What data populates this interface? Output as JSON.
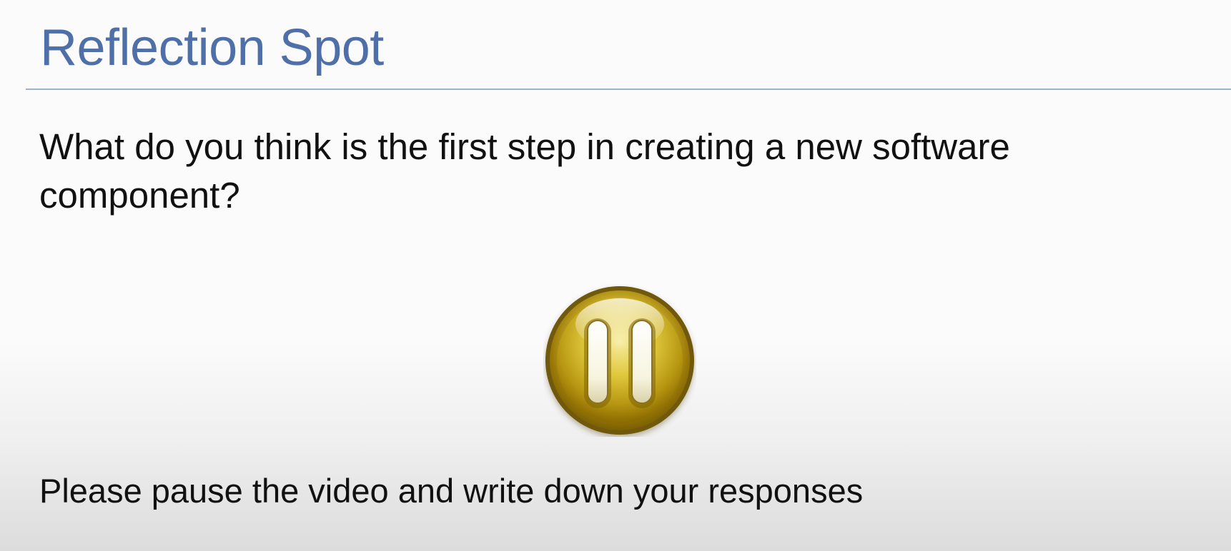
{
  "slide": {
    "title": "Reflection Spot",
    "question": "What do you think is the first step in creating a new software component?",
    "instruction": "Please pause the video and write down your responses",
    "pause_icon": "pause-icon"
  },
  "colors": {
    "title": "#4f6fa8",
    "rule": "#9cb1cc",
    "body_text": "#111111",
    "button_gold": "#d8bd2b"
  }
}
